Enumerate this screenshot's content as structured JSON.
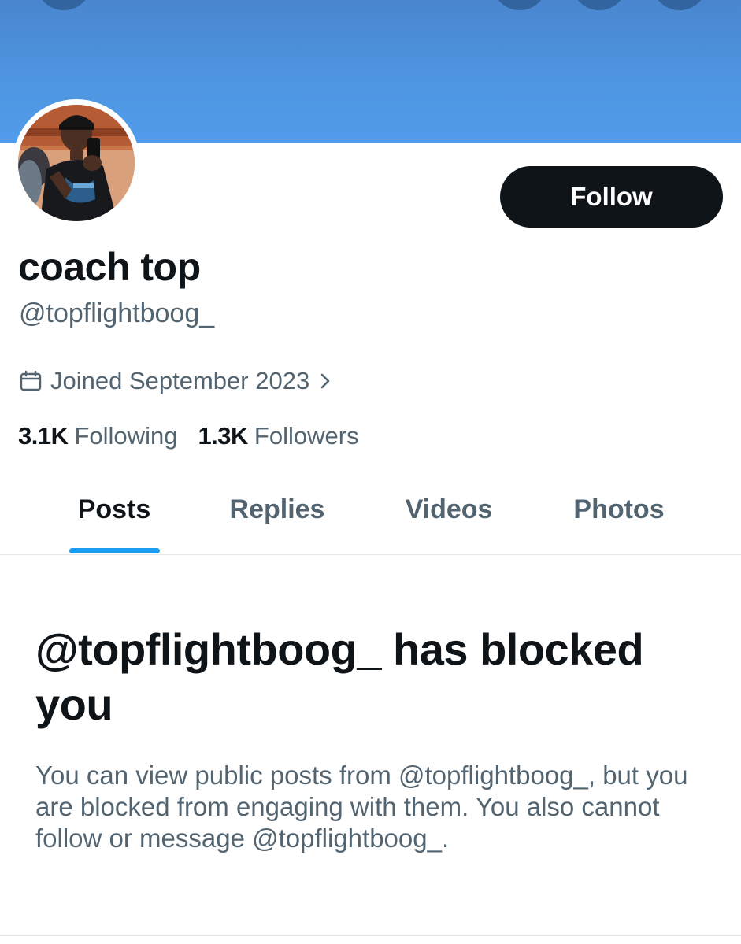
{
  "profile": {
    "display_name": "coach top",
    "handle": "@topflightboog_",
    "joined": "Joined September 2023",
    "follow_label": "Follow"
  },
  "stats": {
    "following_count": "3.1K",
    "following_label": "Following",
    "followers_count": "1.3K",
    "followers_label": "Followers"
  },
  "tabs": [
    {
      "label": "Posts",
      "active": true
    },
    {
      "label": "Replies",
      "active": false
    },
    {
      "label": "Videos",
      "active": false
    },
    {
      "label": "Photos",
      "active": false
    }
  ],
  "blocked": {
    "title": "@topflightboog_ has blocked you",
    "description": "You can view public posts from @topflightboog_, but you are blocked from engaging with them. You also cannot follow or message @topflightboog_."
  },
  "icons": {
    "joined": "calendar-icon",
    "joined_more": "chevron-right-icon"
  },
  "colors": {
    "banner": "#4e95e0",
    "accent": "#1d9bf0",
    "primary_text": "#0f1419",
    "secondary_text": "#536471",
    "button_bg": "#0f1419"
  }
}
